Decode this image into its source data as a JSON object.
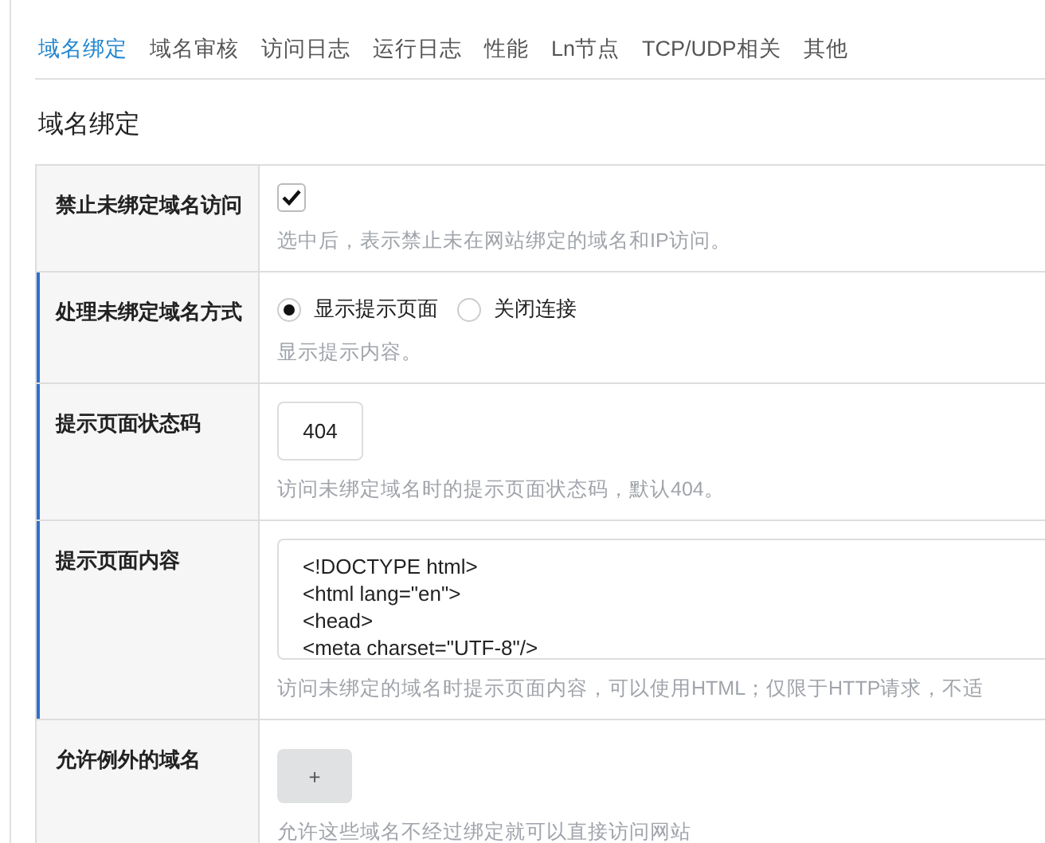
{
  "tabs": [
    {
      "label": "域名绑定",
      "selected": true
    },
    {
      "label": "域名审核",
      "selected": false
    },
    {
      "label": "访问日志",
      "selected": false
    },
    {
      "label": "运行日志",
      "selected": false
    },
    {
      "label": "性能",
      "selected": false
    },
    {
      "label": "Ln节点",
      "selected": false
    },
    {
      "label": "TCP/UDP相关",
      "selected": false
    },
    {
      "label": "其他",
      "selected": false
    }
  ],
  "heading": "域名绑定",
  "rows": [
    {
      "kind": "checkbox",
      "label": "禁止未绑定域名访问",
      "sub_option": false,
      "checked": true,
      "help": "选中后，表示禁止未在网站绑定的域名和IP访问。"
    },
    {
      "kind": "radio",
      "label": "处理未绑定域名方式",
      "sub_option": true,
      "options": [
        {
          "label": "显示提示页面",
          "selected": true
        },
        {
          "label": "关闭连接",
          "selected": false
        }
      ],
      "help": "显示提示内容。"
    },
    {
      "kind": "input",
      "label": "提示页面状态码",
      "sub_option": true,
      "value": "404",
      "help": "访问未绑定域名时的提示页面状态码，默认404。"
    },
    {
      "kind": "textarea",
      "label": "提示页面内容",
      "sub_option": true,
      "value": "<!DOCTYPE html>\n<html lang=\"en\">\n<head>\n<meta charset=\"UTF-8\"/>",
      "help": "访问未绑定的域名时提示页面内容，可以使用HTML；仅限于HTTP请求，不适"
    },
    {
      "kind": "add",
      "label": "允许例外的域名",
      "sub_option": false,
      "button": "+",
      "help": "允许这些域名不经过绑定就可以直接访问网站"
    }
  ]
}
